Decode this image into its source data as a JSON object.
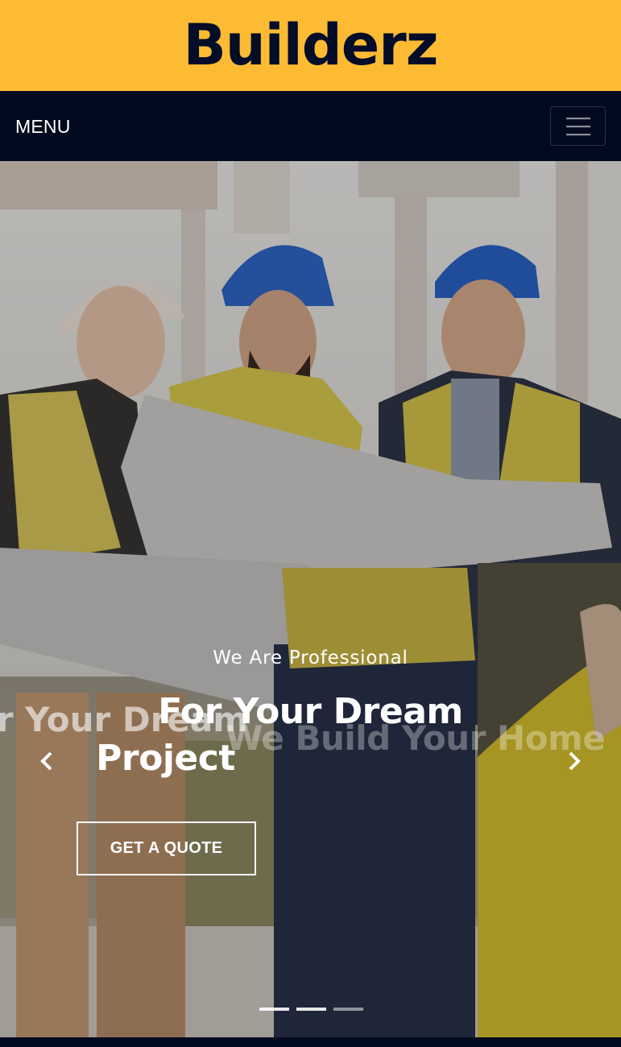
{
  "brand": {
    "name": "Builderz"
  },
  "navbar": {
    "menu_label": "MENU",
    "toggler_icon": "hamburger-icon"
  },
  "carousel": {
    "active_slide": {
      "subtitle": "We Are Professional",
      "title_line1": "For Your Dream",
      "title_line2": "Project",
      "cta_label": "GET A QUOTE"
    },
    "next_slide_title": "We Build Your Home",
    "previous_slide_title": "For Your Dream",
    "prev_icon": "chevron-left-icon",
    "next_icon": "chevron-right-icon",
    "indicator_count": 3
  },
  "colors": {
    "brand_yellow": "#fdbb34",
    "navy": "#010a1f",
    "logo_text": "#040d28",
    "white": "#ffffff"
  }
}
